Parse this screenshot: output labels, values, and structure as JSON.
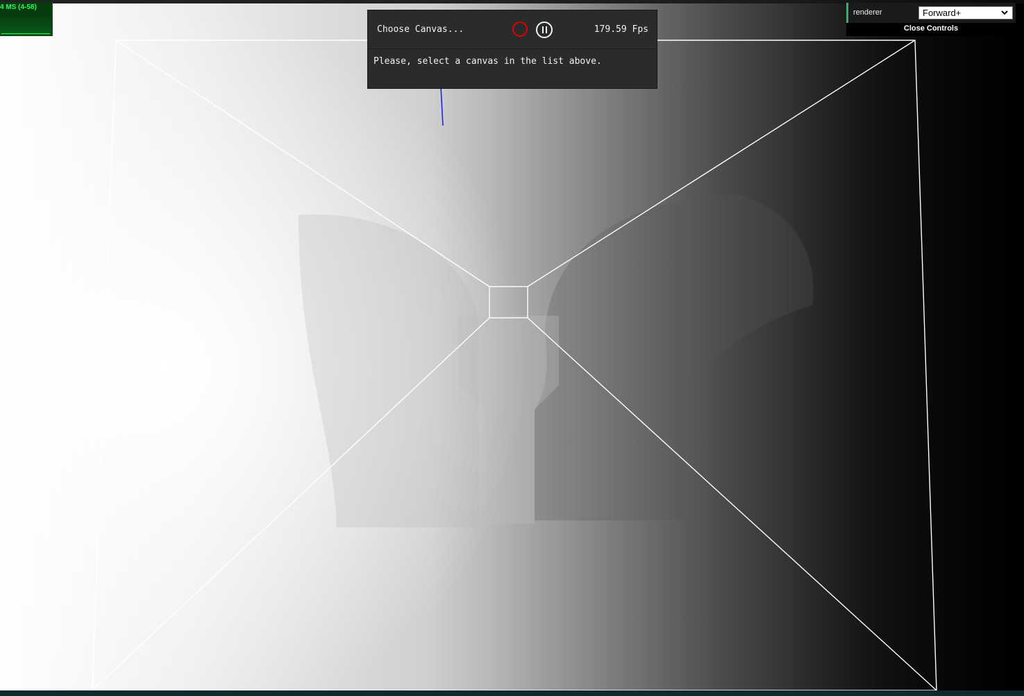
{
  "stats": {
    "label": "4 MS (4-58)"
  },
  "inspector": {
    "choose_canvas": "Choose Canvas...",
    "fps": "179.59 Fps",
    "message": "Please, select a canvas in the list above."
  },
  "controls": {
    "renderer_label": "renderer",
    "renderer_value": "Forward+",
    "close_label": "Close Controls"
  },
  "colors": {
    "stats_text": "#21ff56",
    "record": "#e00000",
    "axis_blue": "#0000ff"
  },
  "icons": {
    "record": "record-icon",
    "pause": "pause-icon",
    "dropdown": "chevron-down-icon"
  }
}
